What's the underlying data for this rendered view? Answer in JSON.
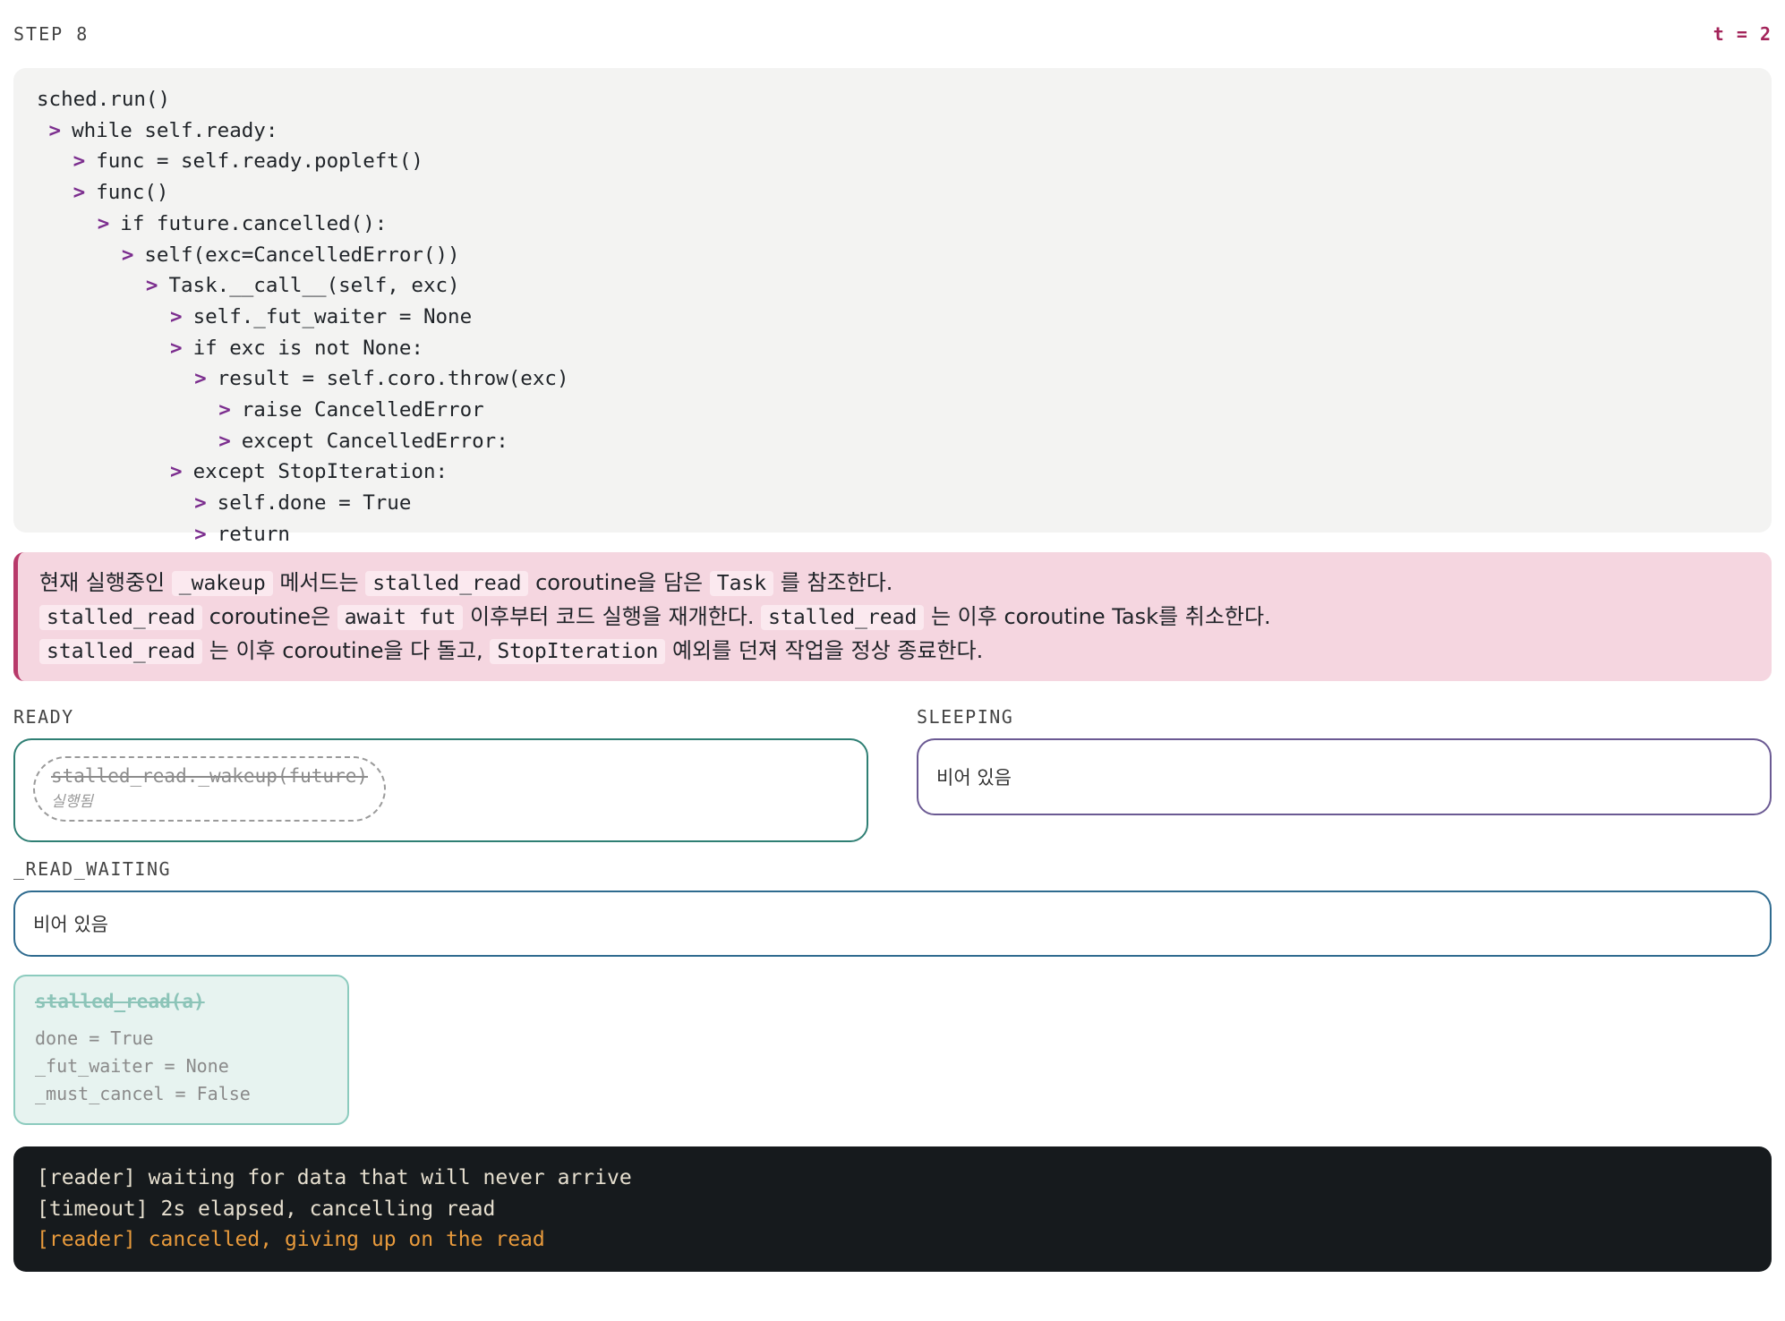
{
  "header": {
    "step": "STEP 8",
    "time": "t = 2"
  },
  "code": [
    {
      "indent": 0,
      "arrow": "",
      "text": "sched.run()"
    },
    {
      "indent": 1,
      "arrow": ">",
      "text": "while self.ready:"
    },
    {
      "indent": 2,
      "arrow": ">",
      "text": "func = self.ready.popleft()"
    },
    {
      "indent": 2,
      "arrow": ">",
      "text": "func()"
    },
    {
      "indent": 3,
      "arrow": ">",
      "text": "if future.cancelled():"
    },
    {
      "indent": 4,
      "arrow": ">",
      "text": "self(exc=CancelledError())"
    },
    {
      "indent": 5,
      "arrow": ">",
      "text": "Task.__call__(self, exc)"
    },
    {
      "indent": 6,
      "arrow": ">",
      "text": "self._fut_waiter = None"
    },
    {
      "indent": 6,
      "arrow": ">",
      "text": "if exc is not None:"
    },
    {
      "indent": 7,
      "arrow": ">",
      "text": "result = self.coro.throw(exc)"
    },
    {
      "indent": 8,
      "arrow": ">",
      "text": "raise CancelledError"
    },
    {
      "indent": 8,
      "arrow": ">",
      "text": "except CancelledError:"
    },
    {
      "indent": 6,
      "arrow": ">",
      "text": "except StopIteration:"
    },
    {
      "indent": 7,
      "arrow": ">",
      "text": "self.done = True"
    },
    {
      "indent": 7,
      "arrow": ">",
      "text": "return"
    }
  ],
  "note": {
    "line1": {
      "t1": "현재 실행중인 ",
      "c1": "_wakeup",
      "t2": " 메서드는 ",
      "c2": "stalled_read",
      "t3": " coroutine을 담은 ",
      "c3": "Task",
      "t4": " 를 참조한다."
    },
    "line2": {
      "c1": "stalled_read",
      "t1": " coroutine은 ",
      "c2": "await fut",
      "t2": " 이후부터 코드 실행을 재개한다. ",
      "c3": "stalled_read",
      "t3": " 는 이후 coroutine Task를 취소한다."
    },
    "line3": {
      "c1": "stalled_read",
      "t1": " 는 이후 coroutine을 다 돌고, ",
      "c2": "StopIteration",
      "t2": " 예외를 던져 작업을 정상 종료한다."
    }
  },
  "ready": {
    "label": "READY",
    "item_title": "stalled_read._wakeup(future)",
    "item_status": "실행됨"
  },
  "sleeping": {
    "label": "SLEEPING",
    "empty": "비어 있음"
  },
  "read_waiting": {
    "label": "_READ_WAITING",
    "empty": "비어 있음"
  },
  "task": {
    "title": "stalled_read(a)",
    "fields": [
      "done = True",
      "_fut_waiter = None",
      "_must_cancel = False"
    ]
  },
  "terminal": [
    {
      "text": "[reader] waiting for data that will never arrive",
      "kind": "normal"
    },
    {
      "text": "[timeout] 2s elapsed, cancelling read",
      "kind": "normal"
    },
    {
      "text": "[reader] cancelled, giving up on the read",
      "kind": "warn"
    }
  ],
  "colors": {
    "accent": "#a3245a",
    "arrow": "#7b2d8e",
    "note_bg": "#f5d6e0",
    "warn": "#e89a3c"
  }
}
